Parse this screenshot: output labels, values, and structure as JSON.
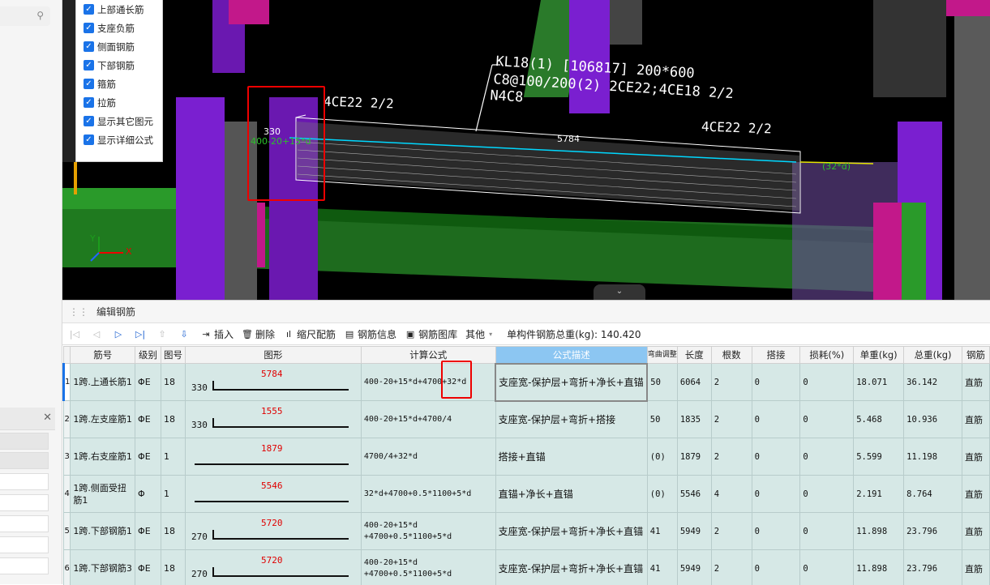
{
  "filter_panel": {
    "items": [
      {
        "label": "上部通长筋",
        "checked": true
      },
      {
        "label": "支座负筋",
        "checked": true
      },
      {
        "label": "侧面钢筋",
        "checked": true
      },
      {
        "label": "下部钢筋",
        "checked": true
      },
      {
        "label": "箍筋",
        "checked": true
      },
      {
        "label": "拉筋",
        "checked": true
      },
      {
        "label": "显示其它图元",
        "checked": true
      },
      {
        "label": "显示详细公式",
        "checked": true
      }
    ]
  },
  "viewport": {
    "beam_label_1": "KL18(1) [106817] 200*600",
    "beam_label_2": "C8@100/200(2) 2CE22;4CE18 2/2",
    "beam_label_3": "N4C8",
    "left_top_label": "4CE22 2/2",
    "right_top_label": "4CE22 2/2",
    "left_dim": "330",
    "left_formula": "400-20+15*d",
    "mid_length": "5784",
    "right_anchor": "(32*d)",
    "collapse_glyph": "⌄"
  },
  "editor": {
    "title": "编辑钢筋",
    "toolbar": {
      "insert": "插入",
      "delete": "删除",
      "scale_rebar": "缩尺配筋",
      "rebar_info": "钢筋信息",
      "rebar_library": "钢筋图库",
      "other": "其他",
      "total_weight": "单构件钢筋总重(kg): 140.420"
    },
    "columns": [
      "筋号",
      "级别",
      "图号",
      "图形",
      "计算公式",
      "公式描述",
      "弯曲调整",
      "长度",
      "根数",
      "搭接",
      "损耗(%)",
      "单重(kg)",
      "总重(kg)",
      "钢筋"
    ],
    "rows": [
      {
        "num": "1",
        "name": "1跨.上通长筋1",
        "grade": "ΦE",
        "fig": "18",
        "left": "330",
        "len": "5784",
        "formula": "400-20+15*d+4700+32*d",
        "desc": "支座宽-保护层+弯折+净长+直锚",
        "bend": "50",
        "length": "6064",
        "count": "2",
        "lap": "0",
        "loss": "0",
        "unit_w": "18.071",
        "total_w": "36.142",
        "type": "直筋"
      },
      {
        "num": "2",
        "name": "1跨.左支座筋1",
        "grade": "ΦE",
        "fig": "18",
        "left": "330",
        "len": "1555",
        "formula": "400-20+15*d+4700/4",
        "desc": "支座宽-保护层+弯折+搭接",
        "bend": "50",
        "length": "1835",
        "count": "2",
        "lap": "0",
        "loss": "0",
        "unit_w": "5.468",
        "total_w": "10.936",
        "type": "直筋"
      },
      {
        "num": "3",
        "name": "1跨.右支座筋1",
        "grade": "ΦE",
        "fig": "1",
        "left": "",
        "len": "1879",
        "formula": "4700/4+32*d",
        "desc": "搭接+直锚",
        "bend": "(0)",
        "length": "1879",
        "count": "2",
        "lap": "0",
        "loss": "0",
        "unit_w": "5.599",
        "total_w": "11.198",
        "type": "直筋"
      },
      {
        "num": "4",
        "name": "1跨.侧面受扭筋1",
        "grade": "Φ",
        "fig": "1",
        "left": "",
        "len": "5546",
        "formula": "32*d+4700+0.5*1100+5*d",
        "desc": "直锚+净长+直锚",
        "bend": "(0)",
        "length": "5546",
        "count": "4",
        "lap": "0",
        "loss": "0",
        "unit_w": "2.191",
        "total_w": "8.764",
        "type": "直筋"
      },
      {
        "num": "5",
        "name": "1跨.下部钢筋1",
        "grade": "ΦE",
        "fig": "18",
        "left": "270",
        "len": "5720",
        "formula": "400-20+15*d +4700+0.5*1100+5*d",
        "desc": "支座宽-保护层+弯折+净长+直锚",
        "bend": "41",
        "length": "5949",
        "count": "2",
        "lap": "0",
        "loss": "0",
        "unit_w": "11.898",
        "total_w": "23.796",
        "type": "直筋"
      },
      {
        "num": "6",
        "name": "1跨.下部钢筋3",
        "grade": "ΦE",
        "fig": "18",
        "left": "270",
        "len": "5720",
        "formula": "400-20+15*d +4700+0.5*1100+5*d",
        "desc": "支座宽-保护层+弯折+净长+直锚",
        "bend": "41",
        "length": "5949",
        "count": "2",
        "lap": "0",
        "loss": "0",
        "unit_w": "11.898",
        "total_w": "23.796",
        "type": "直筋"
      }
    ]
  }
}
